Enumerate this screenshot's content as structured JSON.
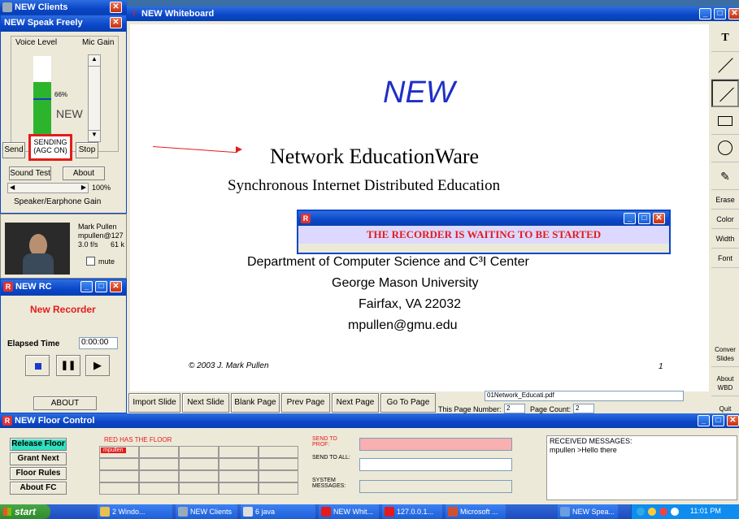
{
  "clients": {
    "title": "NEW Clients"
  },
  "speak": {
    "title": "NEW Speak Freely",
    "voice_level": "Voice Level",
    "mic_gain": "Mic Gain",
    "percent": "66%",
    "new_label": "NEW",
    "send": "Send",
    "sending": "SENDING (AGC ON)",
    "stop": "Stop",
    "sound_test": "Sound Test",
    "about": "About",
    "volume": "100%",
    "speaker_gain": "Speaker/Earphone Gain",
    "voice_level_value": 0.7
  },
  "video": {
    "name": "Mark Pullen",
    "email": "mpullen@127",
    "rate": "3.0 f/s",
    "kbps": "61 k",
    "mute": "mute"
  },
  "rc": {
    "title": "NEW RC",
    "recorder": "New Recorder",
    "elapsed_label": "Elapsed Time",
    "elapsed": "0:00:00",
    "about": "ABOUT"
  },
  "whiteboard": {
    "title": "NEW Whiteboard",
    "slide_title": "NEW",
    "heading": "Network EducationWare",
    "subheading": "Synchronous Internet Distributed Education",
    "line1": "Department of Computer Science and C³I Center",
    "line2": "George Mason University",
    "line3": "Fairfax, VA 22032",
    "line4": "mpullen@gmu.edu",
    "copyright": "© 2003  J. Mark Pullen",
    "page_num": "1",
    "buttons": [
      "Import Slide",
      "Next Slide",
      "Blank Page",
      "Prev Page",
      "Next Page",
      "Go To Page"
    ],
    "file": "01Network_Educati.pdf",
    "this_page_label": "This Page Number:",
    "this_page": "2",
    "page_count_label": "Page Count:",
    "page_count": "2",
    "tools": {
      "text": "T",
      "erase": "Erase",
      "color": "Color",
      "width": "Width",
      "font": "Font",
      "convert": "Conver Slides",
      "about": "About WBD",
      "quit": "Quit"
    }
  },
  "dialog": {
    "message": "THE RECORDER IS WAITING TO BE STARTED"
  },
  "floor": {
    "title": "NEW Floor Control",
    "release": "Release Floor",
    "grant": "Grant Next",
    "rules": "Floor Rules",
    "about": "About FC",
    "red_has_floor": "RED HAS THE FLOOR",
    "holder": "mpullen",
    "send_prof": "SEND TO PROF:",
    "send_all": "SEND TO ALL:",
    "system": "SYSTEM MESSAGES:",
    "received": "RECEIVED MESSAGES:",
    "message": "mpullen >Hello there"
  },
  "taskbar": {
    "start": "start",
    "items": [
      "2 Windo...",
      "NEW Clients",
      "6 java",
      "NEW Whit...",
      "127.0.0.1...",
      "Microsoft ...",
      "NEW Spea..."
    ],
    "time": "11:01 PM"
  },
  "colors": {
    "accent_red": "#e41b1b",
    "title_blue": "#0a46c8",
    "slide_blue": "#1f2fc8"
  }
}
